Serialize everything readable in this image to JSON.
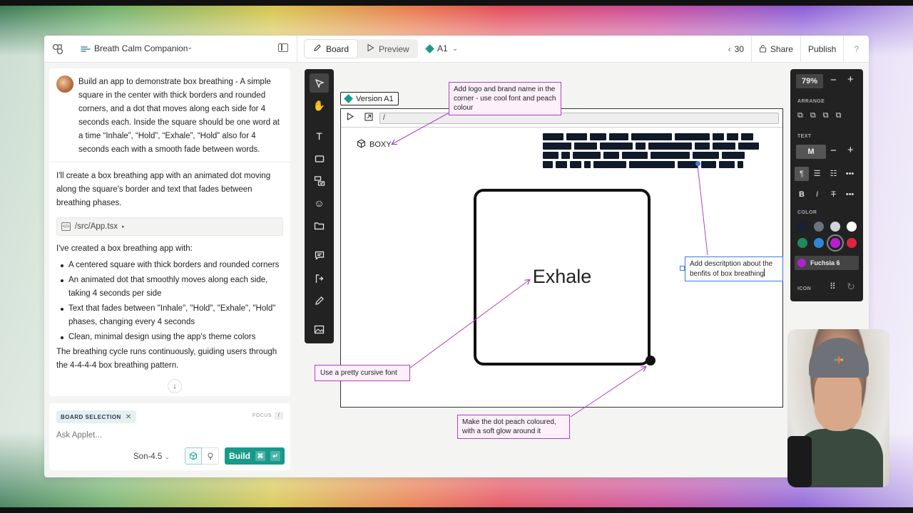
{
  "header": {
    "project_name": "Breath Calm Companion",
    "tabs": [
      {
        "label": "Board",
        "active": true
      },
      {
        "label": "Preview",
        "active": false
      }
    ],
    "version_selector": "A1",
    "history_count": "30",
    "share_label": "Share",
    "publish_label": "Publish",
    "help_label": "?"
  },
  "chat": {
    "user_message": "Build an app to demonstrate box breathing - A simple square in the center with thick borders and rounded corners, and a dot that moves along each side for 4 seconds each. Inside the square should be one word at a time “Inhale”, “Hold”, “Exhale”, “Hold” also for 4 seconds each with a smooth fade between words.",
    "assistant_intro": "I'll create a box breathing app with an animated dot moving along the square's border and text that fades between breathing phases.",
    "file_chip": "/src/App.tsx",
    "assistant_created": "I've created a box breathing app with:",
    "bullets": [
      "A centered square with thick borders and rounded corners",
      "An animated dot that smoothly moves along each side, taking 4 seconds per side",
      "Text that fades between \"Inhale\", \"Hold\", \"Exhale\", \"Hold\" phases, changing every 4 seconds",
      "Clean, minimal design using the app's theme colors"
    ],
    "assistant_outro": "The breathing cycle runs continuously, guiding users through the 4-4-4-4 box breathing pattern."
  },
  "composer": {
    "chip_label": "BOARD SELECTION",
    "focus_label": "FOCUS",
    "focus_key": "/",
    "placeholder": "Ask Applet...",
    "model": "Son-4.5",
    "build_label": "Build"
  },
  "board": {
    "version_tag": "Version A1",
    "url": "/",
    "brand_name": "BOXY",
    "phase_word": "Exhale",
    "annotations": {
      "logo": "Add logo and brand name in the corner - use cool font and peach colour",
      "description": "Add descritption about the benfits of box breathing",
      "font": "Use a pretty cursive font",
      "dot": "Make the dot peach coloured, with a soft glow around it"
    }
  },
  "props": {
    "zoom": "79%",
    "arrange_label": "ARRANGE",
    "text_label": "TEXT",
    "text_size": "M",
    "color_label": "COLOR",
    "color_name": "Fuchsia 6",
    "icon_label": "ICON",
    "colors": [
      "#1b2033",
      "#6b7280",
      "#d1d5db",
      "#ffffff",
      "#1f8a5a",
      "#2f86d9",
      "#b31fd1",
      "#e0243e"
    ],
    "selected_color": "#b31fd1"
  }
}
